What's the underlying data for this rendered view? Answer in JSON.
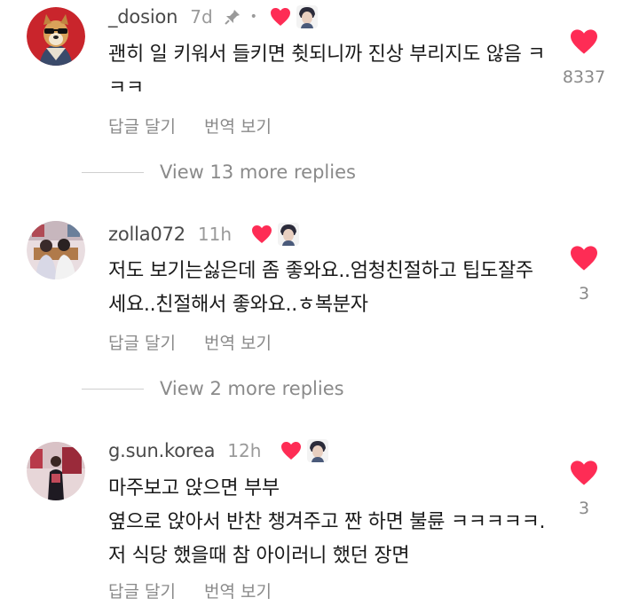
{
  "comments": [
    {
      "username": "_dosion",
      "time": "7d",
      "dot": "•",
      "text": "괜히 일 키워서 들키면 췻되니까 진상 부리지도 않음 ㅋㅋㅋ",
      "likes": "8337",
      "reply_label": "답글 달기",
      "translate_label": "번역 보기",
      "pinned": true
    },
    {
      "username": "zolla072",
      "time": "11h",
      "text": "저도 보기는싫은데 좀 좋와요..엄청친절하고 팁도잘주세요..친절해서 좋와요..ㅎ복분자",
      "likes": "3",
      "reply_label": "답글 달기",
      "translate_label": "번역 보기"
    },
    {
      "username": "g.sun.korea",
      "time": "12h",
      "text": "마주보고 앉으면 부부\n옆으로 앉아서 반찬 챙겨주고 짠 하면 불륜 ㅋㅋㅋㅋㅋ. 저 식당 했을때 참 아이러니 했던 장면",
      "likes": "3",
      "reply_label": "답글 달기",
      "translate_label": "번역 보기"
    }
  ],
  "view_replies": [
    {
      "label": "View 13 more replies"
    },
    {
      "label": "View 2 more replies"
    }
  ],
  "colors": {
    "heart": "#fe2c55",
    "muted": "#8a8a8a",
    "text": "#1a1a1a"
  },
  "icons": {
    "pin": "pin-icon",
    "heart": "heart-icon",
    "creator": "creator-avatar"
  }
}
